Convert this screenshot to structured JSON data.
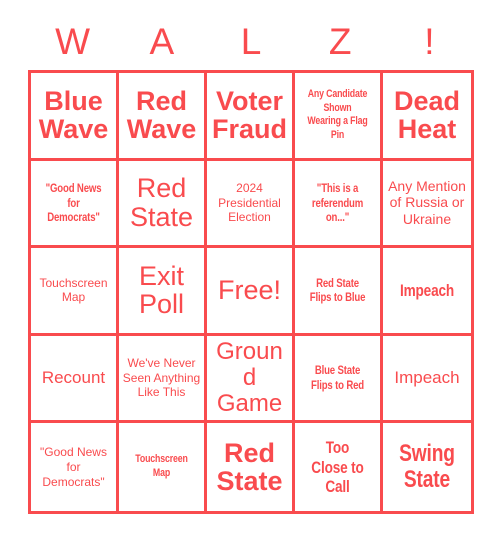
{
  "card": {
    "title_letters": [
      "W",
      "A",
      "L",
      "Z",
      "!"
    ],
    "accent_color": "#f94b4e",
    "background_color": "#ffffff",
    "grid_size": "5x5",
    "free_space_label": "Free!"
  },
  "cells": [
    {
      "text": "Blue Wave",
      "style": "f-bold",
      "size": "s-xl"
    },
    {
      "text": "Red Wave",
      "style": "f-bold",
      "size": "s-xl"
    },
    {
      "text": "Voter Fraud",
      "style": "f-bold",
      "size": "s-xl"
    },
    {
      "text": "Any Candidate Shown Wearing a Flag Pin",
      "style": "f-condensed",
      "size": "s-xxs"
    },
    {
      "text": "Dead Heat",
      "style": "f-bold",
      "size": "s-xl"
    },
    {
      "text": "\"Good News for Democrats\"",
      "style": "f-condensed",
      "size": "s-xs"
    },
    {
      "text": "Red State",
      "style": "f-regular",
      "size": "s-xl"
    },
    {
      "text": "2024 Presidential Election",
      "style": "f-regular",
      "size": "s-xs"
    },
    {
      "text": "\"This is a referendum on...\"",
      "style": "f-condensed",
      "size": "s-xs"
    },
    {
      "text": "Any Mention of Russia or Ukraine",
      "style": "f-regular",
      "size": "s-sm"
    },
    {
      "text": "Touchscreen Map",
      "style": "f-regular",
      "size": "s-xs"
    },
    {
      "text": "Exit Poll",
      "style": "f-regular",
      "size": "s-xl"
    },
    {
      "text": "Free!",
      "style": "f-regular",
      "size": "s-xl"
    },
    {
      "text": "Red State Flips to Blue",
      "style": "f-condensed",
      "size": "s-xs"
    },
    {
      "text": "Impeach",
      "style": "f-condensed",
      "size": "s-md"
    },
    {
      "text": "Recount",
      "style": "f-regular",
      "size": "s-md"
    },
    {
      "text": "We've Never Seen Anything Like This",
      "style": "f-regular",
      "size": "s-xs"
    },
    {
      "text": "Ground Game",
      "style": "f-regular",
      "size": "s-lg"
    },
    {
      "text": "Blue State Flips to Red",
      "style": "f-condensed",
      "size": "s-xs"
    },
    {
      "text": "Impeach",
      "style": "f-regular",
      "size": "s-md"
    },
    {
      "text": "\"Good News for Democrats\"",
      "style": "f-regular",
      "size": "s-xs"
    },
    {
      "text": "Touchscreen Map",
      "style": "f-condensed",
      "size": "s-xxs"
    },
    {
      "text": "Red State",
      "style": "f-bold",
      "size": "s-xl"
    },
    {
      "text": "Too Close to Call",
      "style": "f-condensed",
      "size": "s-md"
    },
    {
      "text": "Swing State",
      "style": "f-condensed",
      "size": "s-lg"
    }
  ]
}
